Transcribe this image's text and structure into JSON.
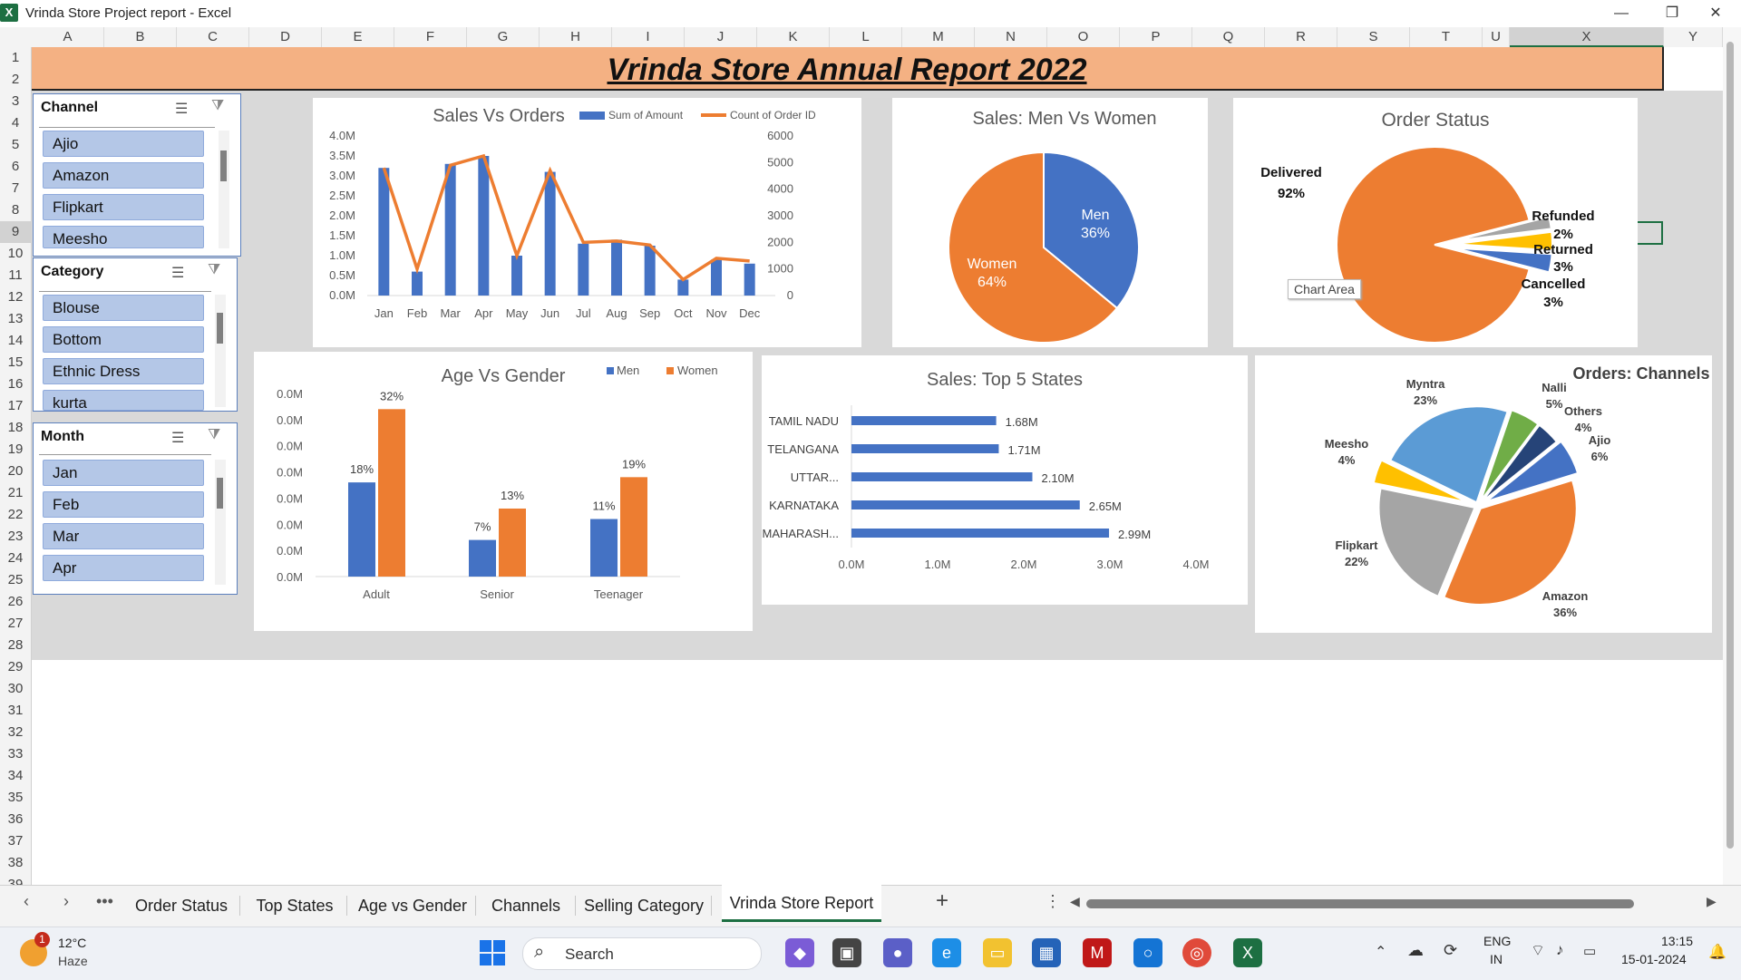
{
  "window": {
    "title": "Vrinda Store Project report - Excel",
    "app_icon": "excel-icon",
    "buttons": [
      "minimize",
      "restore",
      "close"
    ]
  },
  "columns": [
    "A",
    "B",
    "C",
    "D",
    "E",
    "F",
    "G",
    "H",
    "I",
    "J",
    "K",
    "L",
    "M",
    "N",
    "O",
    "P",
    "Q",
    "R",
    "S",
    "T",
    "U",
    "X",
    "Y"
  ],
  "rows": [
    "1",
    "2",
    "3",
    "4",
    "5",
    "6",
    "7",
    "8",
    "9",
    "10",
    "11",
    "12",
    "13",
    "14",
    "15",
    "16",
    "17",
    "18",
    "19",
    "20",
    "21",
    "22",
    "23",
    "24",
    "25",
    "26",
    "27",
    "28",
    "29",
    "30",
    "31",
    "32",
    "33",
    "34",
    "35",
    "36",
    "37",
    "38",
    "39"
  ],
  "banner": {
    "title": "Vrinda Store Annual Report 2022",
    "color": "#f4b183"
  },
  "slicers": {
    "channel": {
      "title": "Channel",
      "items": [
        "Ajio",
        "Amazon",
        "Flipkart",
        "Meesho"
      ]
    },
    "category": {
      "title": "Category",
      "items": [
        "Blouse",
        "Bottom",
        "Ethnic Dress",
        "kurta"
      ]
    },
    "month": {
      "title": "Month",
      "items": [
        "Jan",
        "Feb",
        "Mar",
        "Apr"
      ]
    }
  },
  "tooltip": "Chart Area",
  "colors": {
    "blue": "#4472c4",
    "orange": "#ed7d31",
    "gray": "#a5a5a5",
    "yellow": "#ffc000",
    "lightblue": "#5b9bd5",
    "green": "#70ad47",
    "navy": "#264478"
  },
  "chart_data": [
    {
      "type": "bar+line",
      "title": "Sales Vs Orders",
      "categories": [
        "Jan",
        "Feb",
        "Mar",
        "Apr",
        "May",
        "Jun",
        "Jul",
        "Aug",
        "Sep",
        "Oct",
        "Nov",
        "Dec"
      ],
      "series": [
        {
          "name": "Sum of Amount",
          "type": "bar",
          "axis": "left",
          "values": [
            3.2,
            0.6,
            3.3,
            3.5,
            1.0,
            3.1,
            1.3,
            1.4,
            1.25,
            0.4,
            0.9,
            0.8
          ]
        },
        {
          "name": "Count of Order ID",
          "type": "line",
          "axis": "right",
          "values": [
            4800,
            1000,
            4900,
            5250,
            1500,
            4700,
            2000,
            2050,
            1900,
            600,
            1400,
            1300
          ]
        }
      ],
      "yticks_left": [
        "0.0M",
        "0.5M",
        "1.0M",
        "1.5M",
        "2.0M",
        "2.5M",
        "3.0M",
        "3.5M",
        "4.0M"
      ],
      "yticks_right": [
        "0",
        "1000",
        "2000",
        "3000",
        "4000",
        "5000",
        "6000"
      ],
      "ylim_left": [
        0,
        4.0
      ],
      "ylim_right": [
        0,
        6000
      ],
      "legend": "top"
    },
    {
      "type": "pie",
      "title": "Sales: Men Vs Women",
      "slices": [
        {
          "name": "Men",
          "value": 36,
          "label": "36%"
        },
        {
          "name": "Women",
          "value": 64,
          "label": "64%"
        }
      ]
    },
    {
      "type": "pie",
      "title": "Order Status",
      "slices": [
        {
          "name": "Delivered",
          "value": 92,
          "label": "92%"
        },
        {
          "name": "Refunded",
          "value": 2,
          "label": "2%"
        },
        {
          "name": "Returned",
          "value": 3,
          "label": "3%"
        },
        {
          "name": "Cancelled",
          "value": 3,
          "label": "3%"
        }
      ]
    },
    {
      "type": "bar",
      "title": "Age Vs Gender",
      "categories": [
        "Adult",
        "Senior",
        "Teenager"
      ],
      "series": [
        {
          "name": "Men",
          "values": [
            18,
            7,
            11
          ],
          "labels": [
            "18%",
            "7%",
            "11%"
          ]
        },
        {
          "name": "Women",
          "values": [
            32,
            13,
            19
          ],
          "labels": [
            "32%",
            "13%",
            "19%"
          ]
        }
      ],
      "yticks": [
        "0.0M",
        "0.0M",
        "0.0M",
        "0.0M",
        "0.0M",
        "0.0M",
        "0.0M",
        "0.0M"
      ],
      "ylim": [
        0,
        35
      ],
      "legend": "top"
    },
    {
      "type": "bar",
      "orientation": "horizontal",
      "title": "Sales: Top 5 States",
      "categories": [
        "TAMIL NADU",
        "TELANGANA",
        "UTTAR...",
        "KARNATAKA",
        "MAHARASH..."
      ],
      "values": [
        1.68,
        1.71,
        2.1,
        2.65,
        2.99
      ],
      "labels": [
        "1.68M",
        "1.71M",
        "2.10M",
        "2.65M",
        "2.99M"
      ],
      "xticks": [
        "0.0M",
        "1.0M",
        "2.0M",
        "3.0M",
        "4.0M"
      ],
      "xlim": [
        0,
        4.0
      ]
    },
    {
      "type": "pie",
      "title": "Orders: Channels",
      "slices": [
        {
          "name": "Amazon",
          "value": 36,
          "label": "36%"
        },
        {
          "name": "Flipkart",
          "value": 22,
          "label": "22%"
        },
        {
          "name": "Meesho",
          "value": 4,
          "label": "4%"
        },
        {
          "name": "Myntra",
          "value": 23,
          "label": "23%"
        },
        {
          "name": "Nalli",
          "value": 5,
          "label": "5%"
        },
        {
          "name": "Others",
          "value": 4,
          "label": "4%"
        },
        {
          "name": "Ajio",
          "value": 6,
          "label": "6%"
        }
      ]
    }
  ],
  "sheet_tabs": [
    "Order Status",
    "Top States",
    "Age vs Gender",
    "Channels",
    "Selling Category",
    "Vrinda Store Report"
  ],
  "active_tab": "Vrinda Store Report",
  "taskbar": {
    "weather_temp": "12°C",
    "weather_desc": "Haze",
    "weather_badge": "1",
    "search_placeholder": "Search",
    "lang": "ENG",
    "region": "IN",
    "time": "13:15",
    "date": "15-01-2024"
  }
}
